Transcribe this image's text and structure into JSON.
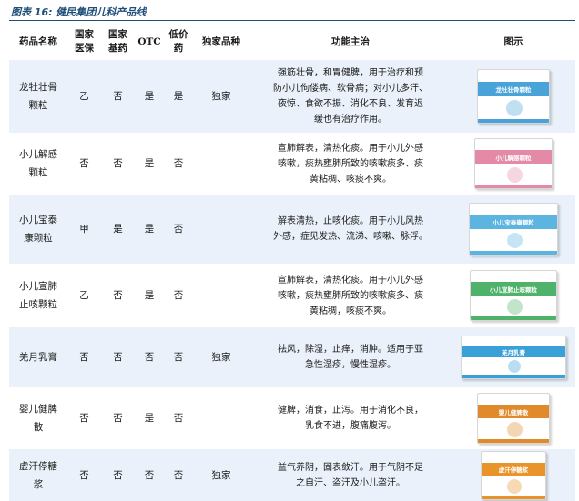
{
  "caption": "图表 16:  健民集团儿科产品线",
  "headers": {
    "name": "药品名称",
    "insurance": "国家\n医保",
    "essential": "国家\n基药",
    "otc": "OTC",
    "lowprice": "低价\n药",
    "exclusive": "独家品种",
    "function": "功能主治",
    "image": "图示"
  },
  "rows": [
    {
      "name": "龙牡壮骨\n颗粒",
      "insurance": "乙",
      "essential": "否",
      "otc": "是",
      "lowprice": "是",
      "exclusive": "独家",
      "function": "强筋壮骨，和胃健脾，用于治疗和预\n防小儿佝偻病、软骨病；对小儿多汗、\n夜惊、食欲不振、消化不良、发育迟\n缓也有治疗作用。",
      "box_label": "龙牡壮骨颗粒",
      "box_color": "#4aa3d8"
    },
    {
      "name": "小儿解感\n颗粒",
      "insurance": "否",
      "essential": "否",
      "otc": "是",
      "lowprice": "否",
      "exclusive": "",
      "function": "宣肺解表，清热化痰。用于小儿外感\n咳嗽，痰热壅肺所致的咳嗽痰多、痰\n黄粘稠、咳痰不爽。",
      "box_label": "小儿解感颗粒",
      "box_color": "#e58aa6"
    },
    {
      "name": "小儿宝泰\n康颗粒",
      "insurance": "甲",
      "essential": "是",
      "otc": "是",
      "lowprice": "否",
      "exclusive": "",
      "function": "解表清热，止咳化痰。用于小儿风热\n外感，症见发热、流涕、咳嗽、脉浮。",
      "box_label": "小儿宝泰康颗粒",
      "box_color": "#5bb5e0"
    },
    {
      "name": "小儿宣肺\n止咳颗粒",
      "insurance": "乙",
      "essential": "否",
      "otc": "是",
      "lowprice": "否",
      "exclusive": "",
      "function": "宣肺解表，清热化痰。用于小儿外感\n咳嗽，痰热壅肺所致的咳嗽痰多、痰\n黄粘稠，咳痰不爽。",
      "box_label": "小儿宣肺止咳颗粒",
      "box_color": "#4fb26a"
    },
    {
      "name": "羌月乳膏",
      "insurance": "否",
      "essential": "否",
      "otc": "否",
      "lowprice": "否",
      "exclusive": "独家",
      "function": "祛风，除湿，止痒，消肿。适用于亚\n急性湿疹，慢性湿疹。",
      "box_label": "羌月乳膏",
      "box_color": "#3aa0d8"
    },
    {
      "name": "婴儿健脾\n散",
      "insurance": "否",
      "essential": "否",
      "otc": "是",
      "lowprice": "否",
      "exclusive": "",
      "function": "健脾，消食，止泻。用于消化不良，\n乳食不进，腹痛腹泻。",
      "box_label": "婴儿健脾散",
      "box_color": "#e08a2c"
    },
    {
      "name": "虚汗停糖\n浆",
      "insurance": "否",
      "essential": "否",
      "otc": "否",
      "lowprice": "否",
      "exclusive": "独家",
      "function": "益气养阴，固表敛汗。用于气阴不足\n之自汗、盗汗及小儿盗汗。",
      "box_label": "虚汗停糖浆",
      "box_color": "#e8942a"
    }
  ]
}
